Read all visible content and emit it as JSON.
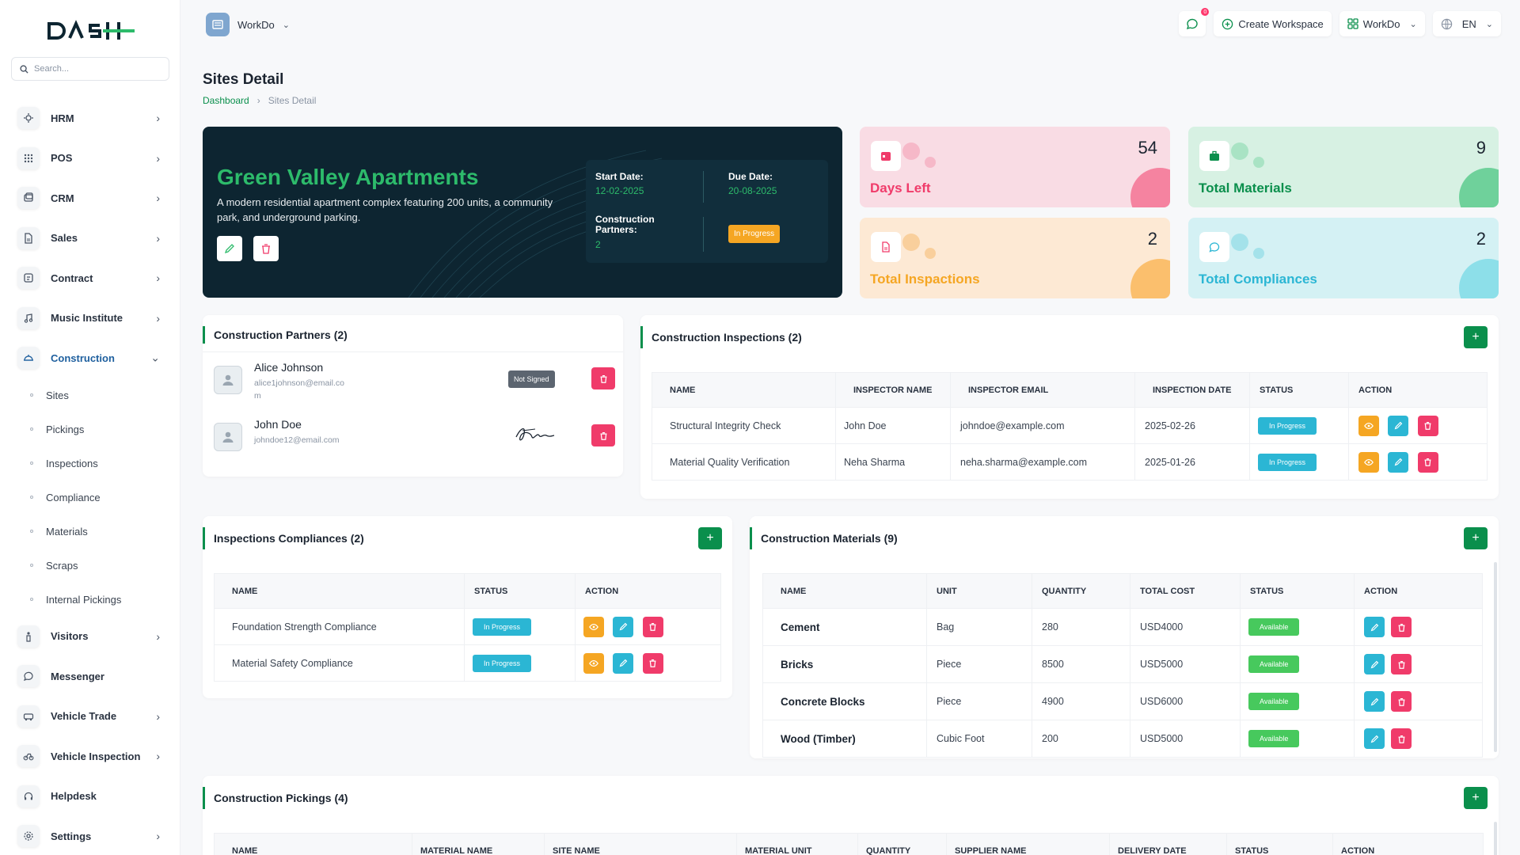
{
  "search": {
    "placeholder": "Search..."
  },
  "sidebar": {
    "items": [
      {
        "label": "HRM",
        "icon": "hrm-icon"
      },
      {
        "label": "POS",
        "icon": "pos-icon"
      },
      {
        "label": "CRM",
        "icon": "crm-icon"
      },
      {
        "label": "Sales",
        "icon": "sales-icon"
      },
      {
        "label": "Contract",
        "icon": "contract-icon"
      },
      {
        "label": "Music Institute",
        "icon": "music-icon"
      },
      {
        "label": "Construction",
        "icon": "construction-icon"
      }
    ],
    "sub_items": [
      "Sites",
      "Pickings",
      "Inspections",
      "Compliance",
      "Materials",
      "Scraps",
      "Internal Pickings"
    ],
    "items_after": [
      {
        "label": "Visitors"
      },
      {
        "label": "Messenger"
      },
      {
        "label": "Vehicle Trade"
      },
      {
        "label": "Vehicle Inspection"
      },
      {
        "label": "Helpdesk"
      },
      {
        "label": "Settings"
      }
    ]
  },
  "topbar": {
    "workspace": "WorkDo",
    "notification_count": "0",
    "create_workspace": "Create Workspace",
    "workspace_menu": "WorkDo",
    "language": "EN"
  },
  "page": {
    "title": "Sites Detail",
    "breadcrumb_home": "Dashboard",
    "breadcrumb_current": "Sites Detail"
  },
  "hero": {
    "title": "Green Valley Apartments",
    "description": "A modern residential apartment complex featuring 200 units, a community park, and underground parking.",
    "start_label": "Start Date:",
    "start_value": "12-02-2025",
    "due_label": "Due Date:",
    "due_value": "20-08-2025",
    "partners_label_1": "Construction",
    "partners_label_2": "Partners:",
    "partners_value": "2",
    "status": "In Progress"
  },
  "stats": {
    "days_left": {
      "value": "54",
      "label": "Days Left",
      "color": "#f9dce4"
    },
    "total_materials": {
      "value": "9",
      "label": "Total Materials",
      "color": "#d7f1e3"
    },
    "total_inspections": {
      "value": "2",
      "label": "Total Inspactions",
      "color": "#fde9d4"
    },
    "total_compliances": {
      "value": "2",
      "label": "Total Compliances",
      "color": "#d4f1f4"
    }
  },
  "partners": {
    "title": "Construction Partners (2)",
    "rows": [
      {
        "name": "Alice Johnson",
        "email_1": "alice1johnson@email.co",
        "email_2": "m",
        "status": "Not Signed"
      },
      {
        "name": "John Doe",
        "email_1": "johndoe12@email.com",
        "email_2": ""
      }
    ]
  },
  "inspections": {
    "title": "Construction Inspections (2)",
    "headers": [
      "NAME",
      "INSPECTOR NAME",
      "INSPECTOR EMAIL",
      "INSPECTION DATE",
      "STATUS",
      "ACTION"
    ],
    "rows": [
      [
        "Structural Integrity Check",
        "John Doe",
        "johndoe@example.com",
        "2025-02-26",
        "In Progress"
      ],
      [
        "Material Quality Verification",
        "Neha Sharma",
        "neha.sharma@example.com",
        "2025-01-26",
        "In Progress"
      ]
    ]
  },
  "compliances": {
    "title": "Inspections Compliances (2)",
    "headers": [
      "NAME",
      "STATUS",
      "ACTION"
    ],
    "rows": [
      [
        "Foundation Strength Compliance",
        "In Progress"
      ],
      [
        "Material Safety Compliance",
        "In Progress"
      ]
    ]
  },
  "materials": {
    "title": "Construction Materials (9)",
    "headers": [
      "NAME",
      "UNIT",
      "QUANTITY",
      "TOTAL COST",
      "STATUS",
      "ACTION"
    ],
    "rows": [
      [
        "Cement",
        "Bag",
        "280",
        "USD4000",
        "Available"
      ],
      [
        "Bricks",
        "Piece",
        "8500",
        "USD5000",
        "Available"
      ],
      [
        "Concrete Blocks",
        "Piece",
        "4900",
        "USD6000",
        "Available"
      ],
      [
        "Wood (Timber)",
        "Cubic Foot",
        "200",
        "USD5000",
        "Available"
      ]
    ]
  },
  "pickings": {
    "title": "Construction Pickings (4)",
    "headers": [
      "NAME",
      "MATERIAL NAME",
      "SITE NAME",
      "MATERIAL UNIT",
      "QUANTITY",
      "SUPPLIER NAME",
      "DELIVERY DATE",
      "STATUS",
      "ACTION"
    ]
  }
}
